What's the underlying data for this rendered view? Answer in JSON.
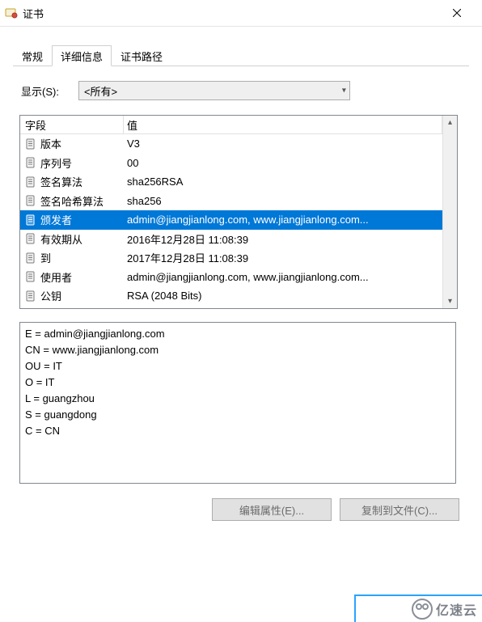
{
  "window": {
    "title": "证书"
  },
  "tabs": [
    {
      "label": "常规"
    },
    {
      "label": "详细信息",
      "active": true
    },
    {
      "label": "证书路径"
    }
  ],
  "show": {
    "label": "显示(S):",
    "value": "<所有>"
  },
  "fields_header": {
    "field": "字段",
    "value": "值"
  },
  "fields": [
    {
      "name": "版本",
      "value": "V3",
      "selected": false
    },
    {
      "name": "序列号",
      "value": "00",
      "selected": false
    },
    {
      "name": "签名算法",
      "value": "sha256RSA",
      "selected": false
    },
    {
      "name": "签名哈希算法",
      "value": "sha256",
      "selected": false
    },
    {
      "name": "颁发者",
      "value": "admin@jiangjianlong.com, www.jiangjianlong.com...",
      "selected": true
    },
    {
      "name": "有效期从",
      "value": "2016年12月28日 11:08:39",
      "selected": false
    },
    {
      "name": "到",
      "value": "2017年12月28日 11:08:39",
      "selected": false
    },
    {
      "name": "使用者",
      "value": "admin@jiangjianlong.com, www.jiangjianlong.com...",
      "selected": false
    },
    {
      "name": "公钥",
      "value": "RSA (2048 Bits)",
      "selected": false
    }
  ],
  "detail_lines": [
    "E = admin@jiangjianlong.com",
    "CN = www.jiangjianlong.com",
    "OU = IT",
    "O = IT",
    "L = guangzhou",
    "S = guangdong",
    "C = CN"
  ],
  "buttons": {
    "edit": "编辑属性(E)...",
    "copy": "复制到文件(C)..."
  },
  "watermark": "亿速云"
}
